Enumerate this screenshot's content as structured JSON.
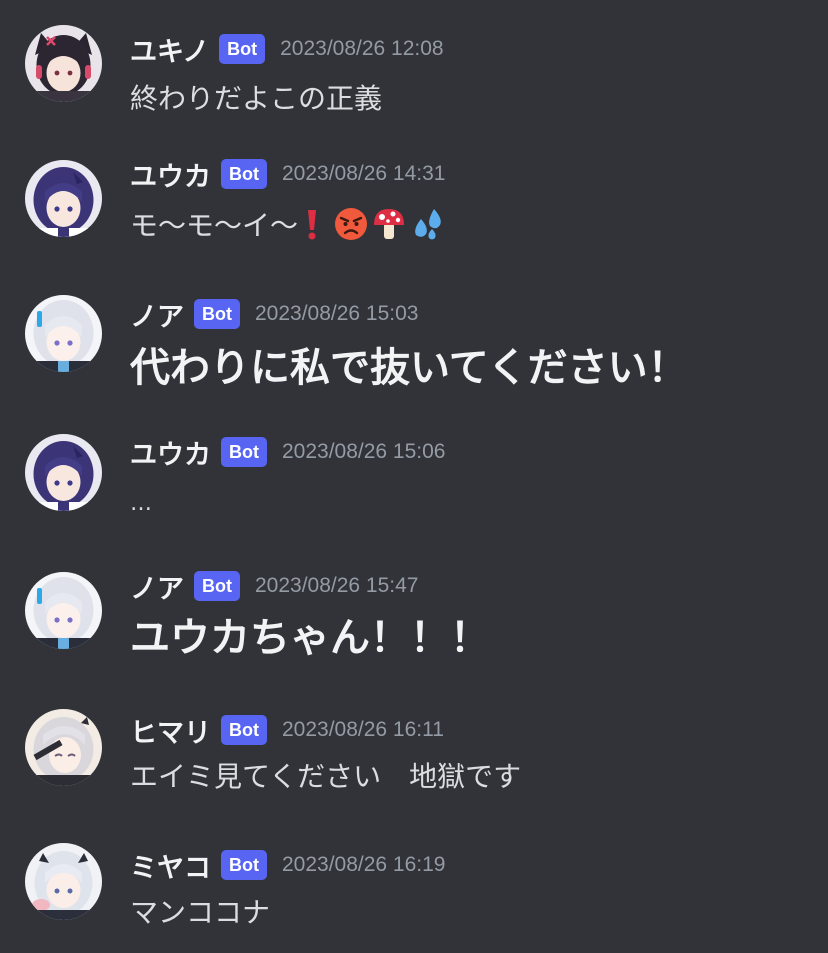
{
  "messages": [
    {
      "id": "m1",
      "username": "ユキノ",
      "tag": "Bot",
      "timestamp": "2023/08/26 12:08",
      "text": "終わりだよこの正義",
      "size": "normal",
      "avatar": "yukino-avatar"
    },
    {
      "id": "m2",
      "username": "ユウカ",
      "tag": "Bot",
      "timestamp": "2023/08/26 14:31",
      "text": "モ〜モ〜イ〜",
      "size": "normal",
      "avatar": "yuuka-avatar",
      "emojis": [
        "exclamation-icon",
        "angry-face-icon",
        "mushroom-icon",
        "sweat-droplets-icon"
      ]
    },
    {
      "id": "m3",
      "username": "ノア",
      "tag": "Bot",
      "timestamp": "2023/08/26 15:03",
      "text": "代わりに私で抜いてください！",
      "size": "big",
      "avatar": "noa-avatar"
    },
    {
      "id": "m4",
      "username": "ユウカ",
      "tag": "Bot",
      "timestamp": "2023/08/26 15:06",
      "text": "…",
      "size": "normal",
      "avatar": "yuuka-avatar"
    },
    {
      "id": "m5",
      "username": "ノア",
      "tag": "Bot",
      "timestamp": "2023/08/26 15:47",
      "text": "ユウカちゃん！！！",
      "size": "big",
      "avatar": "noa-avatar"
    },
    {
      "id": "m6",
      "username": "ヒマリ",
      "tag": "Bot",
      "timestamp": "2023/08/26 16:11",
      "text": "エイミ見てください　地獄です",
      "size": "normal",
      "avatar": "himari-avatar"
    },
    {
      "id": "m7",
      "username": "ミヤコ",
      "tag": "Bot",
      "timestamp": "2023/08/26 16:19",
      "text": "マンココナ",
      "size": "normal",
      "avatar": "miyako-avatar"
    }
  ],
  "colors": {
    "background": "#313338",
    "username": "#f2f3f5",
    "bot_tag": "#5865f2",
    "timestamp": "#949ba4",
    "message_text": "#dbdee1"
  }
}
